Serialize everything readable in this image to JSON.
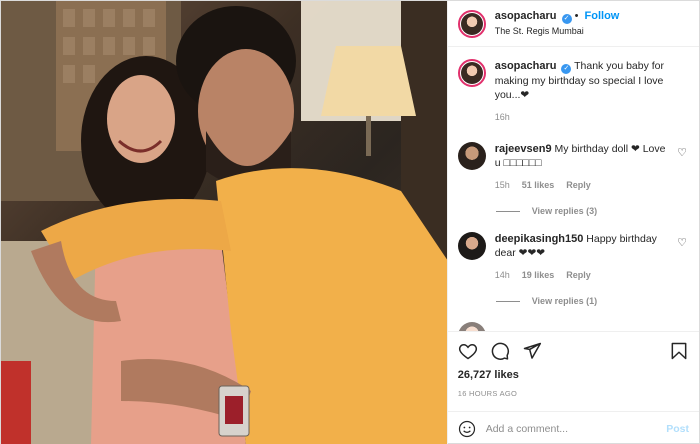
{
  "header": {
    "username": "asopacharu",
    "verified_icon": "verified-badge-icon",
    "separator": "•",
    "follow_label": "Follow",
    "location": "The St. Regis Mumbai"
  },
  "caption": {
    "username": "asopacharu",
    "text": "Thank you baby for making my birthday so special I love you...❤",
    "time": "16h"
  },
  "comments": [
    {
      "username": "rajeevsen9",
      "text": "My birthday doll ❤ Love u □□□□□□",
      "time": "15h",
      "likes": "51 likes",
      "reply": "Reply",
      "view_replies": "View replies (3)"
    },
    {
      "username": "deepikasingh150",
      "text": "Happy birthday dear ❤❤❤",
      "time": "14h",
      "likes": "19 likes",
      "reply": "Reply",
      "view_replies": "View replies (1)"
    }
  ],
  "actions": {
    "icons": [
      "heart-icon",
      "comment-icon",
      "share-icon",
      "bookmark-icon"
    ]
  },
  "likes_count": "26,727 likes",
  "timestamp": "16 HOURS AGO",
  "add_comment": {
    "placeholder": "Add a comment...",
    "post_label": "Post"
  },
  "colors": {
    "accent": "#0095f6",
    "verified": "#3897f0",
    "muted": "#8e8e8e"
  }
}
